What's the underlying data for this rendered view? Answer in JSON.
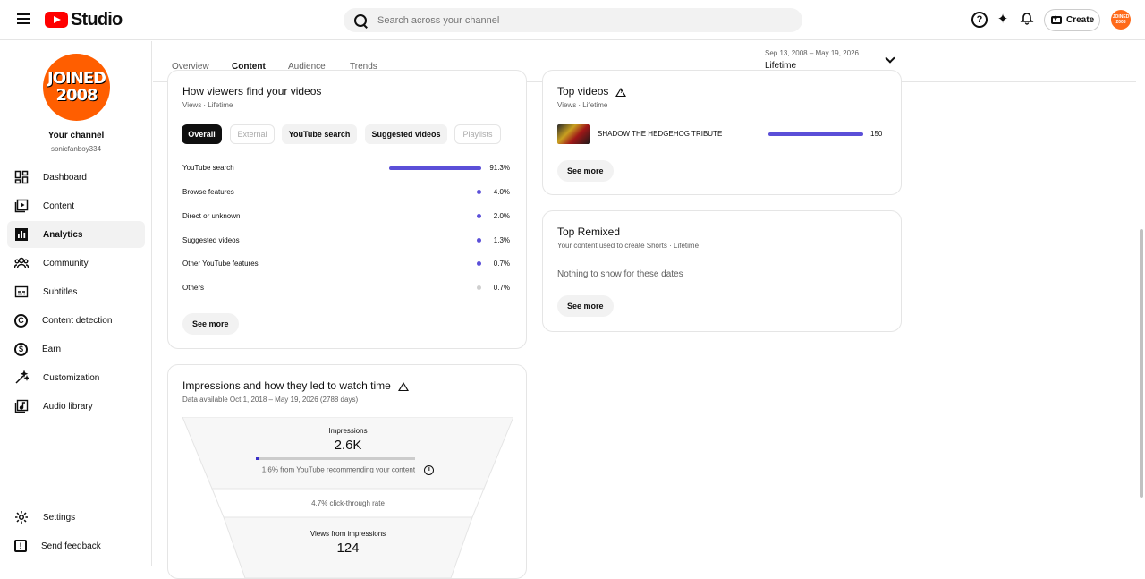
{
  "header": {
    "app_name": "Studio",
    "search_placeholder": "Search across your channel",
    "help_glyph": "?",
    "create_label": "Create",
    "avatar_text": "JOINED 2008"
  },
  "sidebar": {
    "avatar_text_line1": "JOINED",
    "avatar_text_line2": "2008",
    "channel_title": "Your channel",
    "channel_handle": "sonicfanboy334",
    "items": [
      {
        "label": "Dashboard",
        "icon": "dashboard-icon"
      },
      {
        "label": "Content",
        "icon": "content-icon"
      },
      {
        "label": "Analytics",
        "icon": "analytics-icon",
        "active": true
      },
      {
        "label": "Community",
        "icon": "community-icon"
      },
      {
        "label": "Subtitles",
        "icon": "subtitles-icon"
      },
      {
        "label": "Content detection",
        "icon": "content-detection-icon",
        "glyph": "C"
      },
      {
        "label": "Earn",
        "icon": "earn-icon",
        "glyph": "$"
      },
      {
        "label": "Customization",
        "icon": "customization-icon"
      },
      {
        "label": "Audio library",
        "icon": "audio-library-icon"
      }
    ],
    "footer": [
      {
        "label": "Settings",
        "icon": "settings-icon"
      },
      {
        "label": "Send feedback",
        "icon": "feedback-icon",
        "glyph": "!"
      }
    ]
  },
  "tabs": [
    "Overview",
    "Content",
    "Audience",
    "Trends"
  ],
  "active_tab": "Content",
  "date_range": {
    "range": "Sep 13, 2008 – May 19, 2026",
    "label": "Lifetime"
  },
  "viewers_card": {
    "title": "How viewers find your videos",
    "subtitle": "Views · Lifetime",
    "chips": [
      "Overall",
      "External",
      "YouTube search",
      "Suggested videos",
      "Playlists"
    ],
    "sources": [
      {
        "name": "YouTube search",
        "pct": "91.3%",
        "value": 91.3
      },
      {
        "name": "Browse features",
        "pct": "4.0%",
        "value": 4.0
      },
      {
        "name": "Direct or unknown",
        "pct": "2.0%",
        "value": 2.0
      },
      {
        "name": "Suggested videos",
        "pct": "1.3%",
        "value": 1.3
      },
      {
        "name": "Other YouTube features",
        "pct": "0.7%",
        "value": 0.7
      },
      {
        "name": "Others",
        "pct": "0.7%",
        "value": 0.7
      }
    ],
    "see_more": "See more"
  },
  "top_videos": {
    "title": "Top videos",
    "subtitle": "Views · Lifetime",
    "videos": [
      {
        "title": "SHADOW THE HEDGEHOG TRIBUTE",
        "views": "150",
        "bar_fraction": 1.0
      }
    ],
    "see_more": "See more"
  },
  "top_remixed": {
    "title": "Top Remixed",
    "subtitle": "Your content used to create Shorts · Lifetime",
    "empty_text": "Nothing to show for these dates",
    "see_more": "See more"
  },
  "impressions": {
    "title": "Impressions and how they led to watch time",
    "subtitle": "Data available Oct 1, 2018 – May 19, 2026 (2788 days)",
    "impressions_label": "Impressions",
    "impressions_value": "2.6K",
    "rec_fraction": 0.016,
    "rec_text": "1.6% from YouTube recommending your content",
    "info_glyph": "i",
    "ctr_text": "4.7% click-through rate",
    "views_label": "Views from impressions",
    "views_value": "124"
  }
}
